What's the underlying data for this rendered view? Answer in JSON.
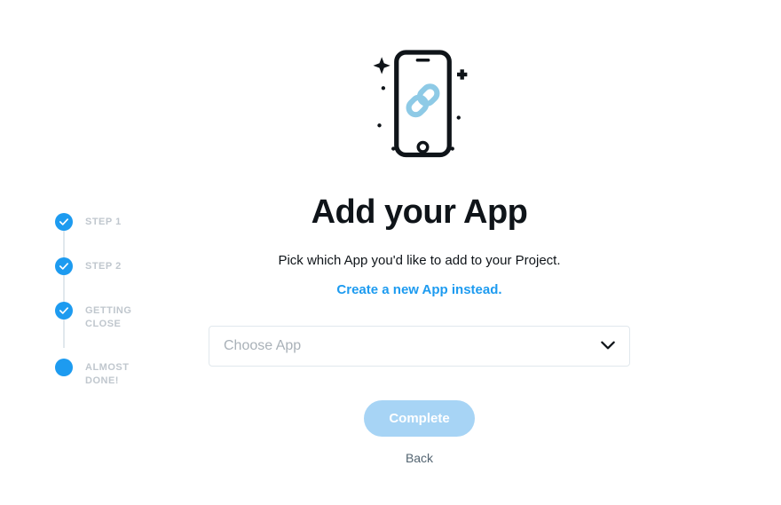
{
  "sidebar": {
    "steps": [
      {
        "label": "STEP 1",
        "completed": true
      },
      {
        "label": "STEP 2",
        "completed": true
      },
      {
        "label": "GETTING CLOSE",
        "completed": true
      },
      {
        "label": "ALMOST DONE!",
        "completed": false
      }
    ]
  },
  "main": {
    "title": "Add your App",
    "subtitle": "Pick which App you'd like to add to your Project.",
    "link_text": "Create a new App instead.",
    "select_placeholder": "Choose App",
    "primary_button": "Complete",
    "back_button": "Back"
  },
  "colors": {
    "accent": "#1d9bf0",
    "primary_button_bg": "#a7d4f5"
  }
}
